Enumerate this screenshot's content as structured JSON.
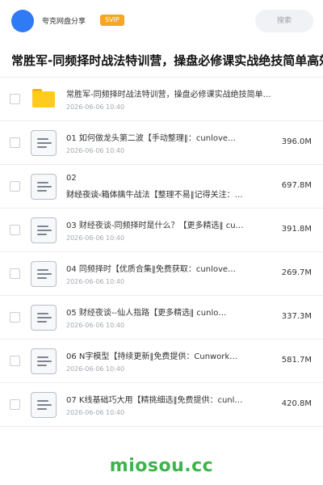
{
  "header": {
    "share_title": "夸克网盘分享",
    "badge": "SVIP",
    "search_placeholder": "搜索",
    "avatar_color": "#2f7bf5"
  },
  "folder_title": "常胜军-同频择时战法特训营，操盘必修课实战绝技简单高效",
  "files": [
    {
      "type": "folder",
      "name": "常胜军-同频择时战法特训营，操盘必修课实战绝技简单…",
      "date": "2026-06-06 10:40",
      "size": ""
    },
    {
      "type": "doc",
      "name": "01 如何做龙头第二波【手动整理‖：cunlove…",
      "date": "2026-06-06 10:40",
      "size": "396.0M"
    },
    {
      "type": "doc",
      "name_line1": "02",
      "name_line2": "财经夜谈-箱体擒牛战法【整理不易‖记得关注：…",
      "date": "2026-06-06 10:40",
      "size": "697.8M"
    },
    {
      "type": "doc",
      "name": "03 财经夜谈-同频择时是什么？【更多精选‖ cu…",
      "date": "2026-06-06 10:40",
      "size": "391.8M"
    },
    {
      "type": "doc",
      "name": "04 同频择时【优质合集‖免费获取：cunlove…",
      "date": "2026-06-06 10:40",
      "size": "269.7M"
    },
    {
      "type": "doc",
      "name": "05 财经夜谈--仙人指路【更多精选‖ cunlo…",
      "date": "2026-06-06 10:40",
      "size": "337.3M"
    },
    {
      "type": "doc",
      "name": "06 N字模型【持续更新‖免费提供：Cunwork…",
      "date": "2026-06-06 10:40",
      "size": "581.7M"
    },
    {
      "type": "doc",
      "name": "07 K线基础巧大用【精挑细选‖免费提供：cunl…",
      "date": "2026-06-06 10:40",
      "size": "420.8M"
    }
  ],
  "watermark": "miosou.cc",
  "colors": {
    "badge": "#f7a427",
    "folder": "#ffcb1f",
    "watermark": "#3bb54a"
  }
}
